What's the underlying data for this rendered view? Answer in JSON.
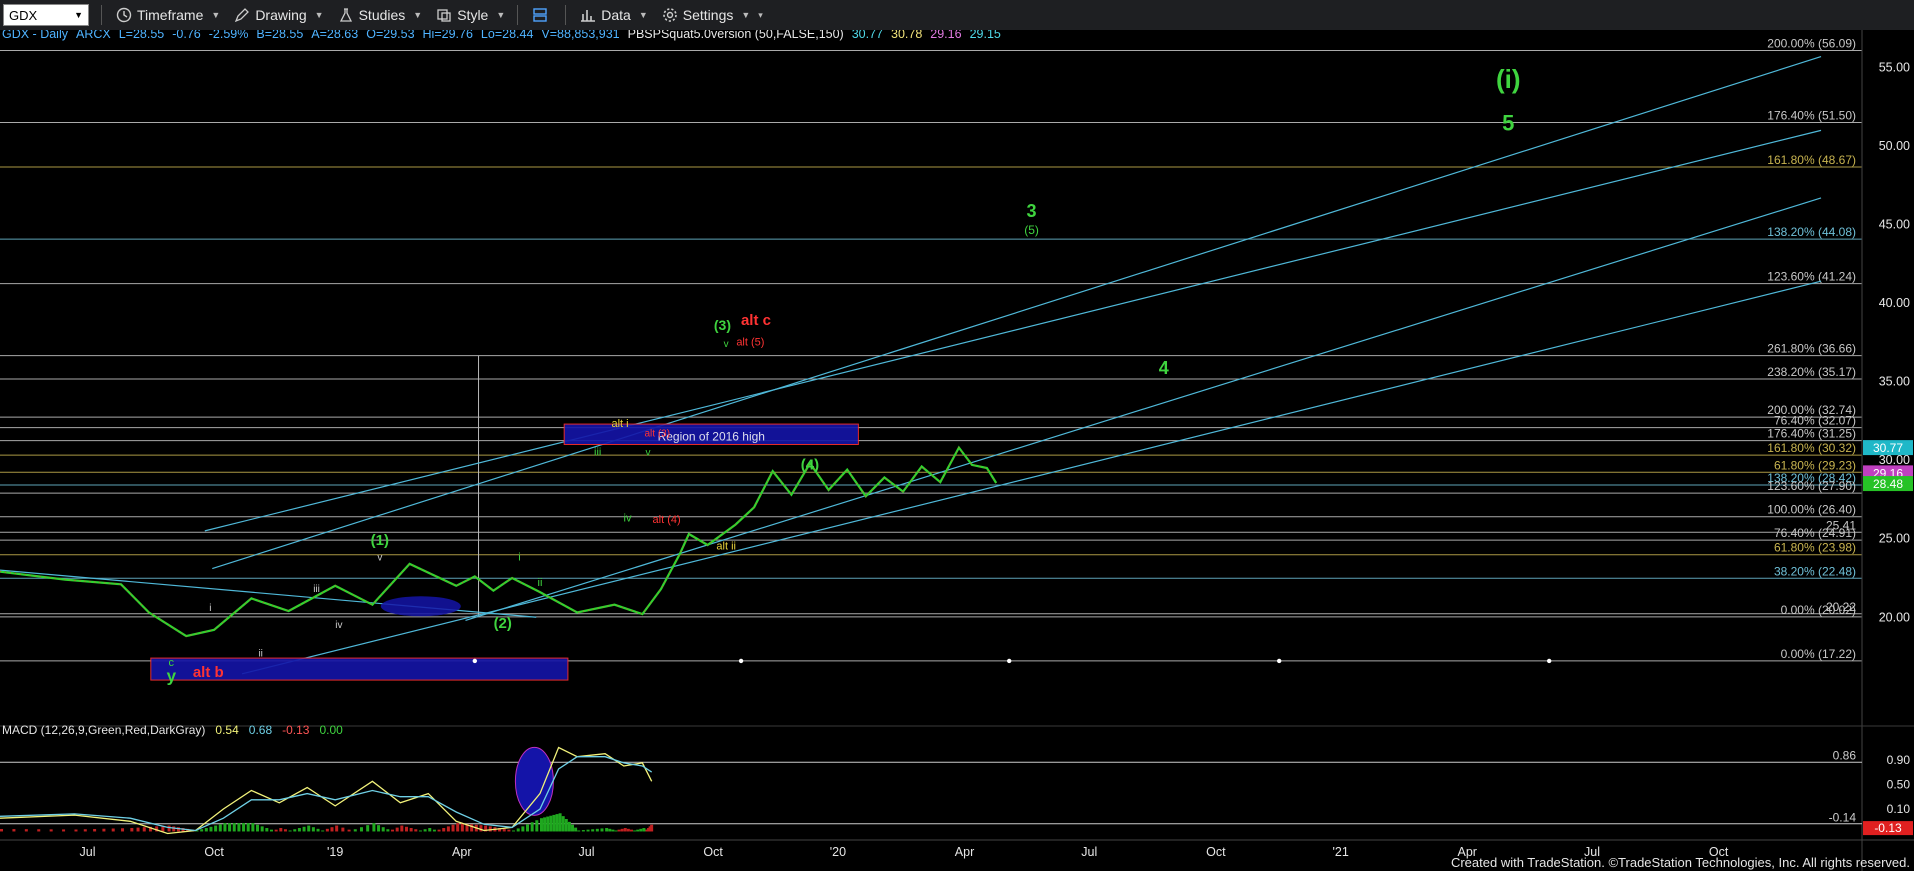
{
  "toolbar": {
    "symbol": "GDX",
    "items": [
      {
        "label": "Timeframe",
        "icon": "clock-icon"
      },
      {
        "label": "Drawing",
        "icon": "pencil-icon"
      },
      {
        "label": "Studies",
        "icon": "flask-icon"
      },
      {
        "label": "Style",
        "icon": "chart-style-icon"
      },
      {
        "label": "",
        "icon": "layout-icon"
      },
      {
        "label": "Data",
        "icon": "data-bars-icon"
      },
      {
        "label": "Settings",
        "icon": "gear-icon"
      }
    ]
  },
  "colors": {
    "background": "#000000",
    "up": "#2fd42f",
    "down": "#ff3030",
    "channel": "#4fb8d8",
    "fib": "#c8c8c8",
    "green_label": "#3fd43f",
    "red_label": "#ff3333",
    "yellow_label": "#e8d33a",
    "macd_line": "#f2f27a",
    "signal_line": "#6fd0e6"
  },
  "header": {
    "segments": [
      {
        "text": "GDX - Daily",
        "color": "#4fb3ff"
      },
      {
        "text": "ARCX",
        "color": "#4fb3ff"
      },
      {
        "text": "L=28.55",
        "color": "#4fb3ff"
      },
      {
        "text": "-0.76",
        "color": "#4fb3ff"
      },
      {
        "text": "-2.59%",
        "color": "#4fb3ff"
      },
      {
        "text": "B=28.55",
        "color": "#4fb3ff"
      },
      {
        "text": "A=28.63",
        "color": "#4fb3ff"
      },
      {
        "text": "O=29.53",
        "color": "#4fb3ff"
      },
      {
        "text": "Hi=29.76",
        "color": "#4fb3ff"
      },
      {
        "text": "Lo=28.44",
        "color": "#4fb3ff"
      },
      {
        "text": "V=88,853,931",
        "color": "#4fb3ff"
      },
      {
        "text": "PBSPSquat5.0version (50,FALSE,150)",
        "color": "#e6e6e6"
      },
      {
        "text": "30.77",
        "color": "#4fd8e8"
      },
      {
        "text": "30.78",
        "color": "#f0e27a"
      },
      {
        "text": "29.16",
        "color": "#e07ae0"
      },
      {
        "text": "29.15",
        "color": "#4fd8e8"
      }
    ]
  },
  "macd_header": {
    "segments": [
      {
        "text": "MACD (12,26,9,Green,Red,DarkGray)",
        "color": "#e6e6e6"
      },
      {
        "text": "0.54",
        "color": "#f2f27a"
      },
      {
        "text": "0.68",
        "color": "#6fd0e6"
      },
      {
        "text": "-0.13",
        "color": "#ff5555"
      },
      {
        "text": "0.00",
        "color": "#3fd43f"
      }
    ]
  },
  "footer": {
    "credit": "Created with TradeStation. ©TradeStation Technologies, Inc. All rights reserved."
  },
  "chart_data": {
    "type": "candlestick",
    "symbol": "GDX - Daily",
    "x_ticks": [
      "Jul",
      "Oct",
      "'19",
      "Apr",
      "Jul",
      "Oct",
      "'20",
      "Apr",
      "Jul",
      "Oct",
      "'21",
      "Apr",
      "Jul",
      "Oct"
    ],
    "y_ticks": [
      20.0,
      25.0,
      30.0,
      35.0,
      40.0,
      45.0,
      50.0,
      55.0
    ],
    "ylim": [
      15.75,
      56.5
    ],
    "price_path": {
      "x": [
        0,
        0.035,
        0.065,
        0.08,
        0.1,
        0.115,
        0.135,
        0.155,
        0.18,
        0.2,
        0.22,
        0.245,
        0.255,
        0.265,
        0.275,
        0.29,
        0.31,
        0.33,
        0.345,
        0.355,
        0.365,
        0.37,
        0.38,
        0.395,
        0.405,
        0.415,
        0.425,
        0.435,
        0.445,
        0.455,
        0.465,
        0.475,
        0.485,
        0.495,
        0.505,
        0.515,
        0.522,
        0.53,
        0.535
      ],
      "y": [
        22.9,
        22.4,
        22.1,
        20.3,
        18.8,
        19.2,
        21.2,
        20.4,
        22.0,
        20.8,
        23.4,
        22.0,
        22.6,
        21.7,
        22.5,
        21.6,
        20.3,
        20.8,
        20.2,
        21.8,
        24.0,
        25.3,
        24.6,
        25.9,
        27.0,
        29.3,
        27.8,
        29.8,
        28.1,
        29.4,
        27.7,
        28.9,
        28.0,
        29.6,
        28.6,
        30.8,
        29.7,
        29.5,
        28.55
      ]
    },
    "fib_levels": [
      {
        "label": "200.00% (56.09)",
        "value": 56.09,
        "color": "#c8c8c8"
      },
      {
        "label": "176.40% (51.50)",
        "value": 51.5,
        "color": "#c8c8c8"
      },
      {
        "label": "161.80% (48.67)",
        "value": 48.67,
        "color": "#c8b450"
      },
      {
        "label": "138.20% (44.08)",
        "value": 44.08,
        "color": "#6fc0d8"
      },
      {
        "label": "123.60% (41.24)",
        "value": 41.24,
        "color": "#c8c8c8"
      },
      {
        "label": "261.80% (36.66)",
        "value": 36.66,
        "color": "#c8c8c8"
      },
      {
        "label": "238.20% (35.17)",
        "value": 35.17,
        "color": "#c8c8c8"
      },
      {
        "label": "200.00% (32.74)",
        "value": 32.74,
        "color": "#c8c8c8"
      },
      {
        "label": "76.40% (32.07)",
        "value": 32.07,
        "color": "#c8c8c8"
      },
      {
        "label": "176.40% (31.25)",
        "value": 31.25,
        "color": "#c8c8c8"
      },
      {
        "label": "161.80% (30.32)",
        "value": 30.32,
        "color": "#c8b450"
      },
      {
        "label": "61.80% (29.23)",
        "value": 29.23,
        "color": "#c8b450"
      },
      {
        "label": "138.20% (28.42)",
        "value": 28.42,
        "color": "#6fc0d8"
      },
      {
        "label": "123.60% (27.90)",
        "value": 27.9,
        "color": "#c8c8c8"
      },
      {
        "label": "100.00% (26.40)",
        "value": 26.4,
        "color": "#c8c8c8"
      },
      {
        "label": "25.41",
        "value": 25.41,
        "color": "#c8c8c8"
      },
      {
        "label": "76.40% (24.91)",
        "value": 24.91,
        "color": "#c8c8c8"
      },
      {
        "label": "61.80% (23.98)",
        "value": 23.98,
        "color": "#c8b450"
      },
      {
        "label": "38.20% (22.48)",
        "value": 22.48,
        "color": "#6fc0d8"
      },
      {
        "label": "20.22",
        "value": 20.22,
        "color": "#c8c8c8"
      },
      {
        "label": "0.00% (20.02)",
        "value": 20.02,
        "color": "#c8c8c8"
      },
      {
        "label": "0.00% (17.22)",
        "value": 17.22,
        "color": "#c8c8c8"
      }
    ],
    "price_badges": [
      {
        "text": "30.77",
        "value": 30.77,
        "bg": "#1fb8c8"
      },
      {
        "text": "29.16",
        "value": 29.16,
        "bg": "#c040c0"
      },
      {
        "text": "28.48",
        "value": 28.48,
        "bg": "#26c226"
      }
    ],
    "regions": [
      {
        "label": "Region of 2016 high",
        "x0": 0.303,
        "x1": 0.461,
        "y0": 31.0,
        "y1": 32.3
      },
      {
        "label": "alt b",
        "x0": 0.081,
        "x1": 0.305,
        "y0": 16.0,
        "y1": 17.4
      }
    ],
    "wave_labels": [
      {
        "text": "(i)",
        "x": 0.81,
        "y": 53.7,
        "color": "#3fd43f",
        "size": 26
      },
      {
        "text": "5",
        "x": 0.81,
        "y": 51.0,
        "color": "#3fd43f",
        "size": 22
      },
      {
        "text": "3",
        "x": 0.554,
        "y": 45.5,
        "color": "#3fd43f",
        "size": 18
      },
      {
        "text": "(5)",
        "x": 0.554,
        "y": 44.4,
        "color": "#3fd43f",
        "size": 12
      },
      {
        "text": "4",
        "x": 0.625,
        "y": 35.5,
        "color": "#3fd43f",
        "size": 18
      },
      {
        "text": "(4)",
        "x": 0.435,
        "y": 29.4,
        "color": "#3fd43f",
        "size": 15
      },
      {
        "text": "(3)",
        "x": 0.388,
        "y": 38.3,
        "color": "#3fd43f",
        "size": 14
      },
      {
        "text": "v",
        "x": 0.39,
        "y": 37.2,
        "color": "#3fd43f",
        "size": 10
      },
      {
        "text": "alt c",
        "x": 0.406,
        "y": 38.6,
        "color": "#ff3333",
        "size": 15
      },
      {
        "text": "alt (5)",
        "x": 0.403,
        "y": 37.3,
        "color": "#ff3333",
        "size": 11
      },
      {
        "text": "alt i",
        "x": 0.333,
        "y": 32.1,
        "color": "#e8d33a",
        "size": 11
      },
      {
        "text": "alt (3)",
        "x": 0.353,
        "y": 31.5,
        "color": "#ff3333",
        "size": 10
      },
      {
        "text": "iii",
        "x": 0.321,
        "y": 30.3,
        "color": "#3fd43f",
        "size": 11
      },
      {
        "text": "v",
        "x": 0.348,
        "y": 30.3,
        "color": "#3fd43f",
        "size": 10
      },
      {
        "text": "iv",
        "x": 0.337,
        "y": 26.1,
        "color": "#3fd43f",
        "size": 11
      },
      {
        "text": "alt (4)",
        "x": 0.358,
        "y": 26.0,
        "color": "#ff3333",
        "size": 11
      },
      {
        "text": "alt ii",
        "x": 0.39,
        "y": 24.3,
        "color": "#e8d33a",
        "size": 11
      },
      {
        "text": "i",
        "x": 0.279,
        "y": 23.6,
        "color": "#3fd43f",
        "size": 11
      },
      {
        "text": "ii",
        "x": 0.29,
        "y": 22.0,
        "color": "#3fd43f",
        "size": 11
      },
      {
        "text": "(1)",
        "x": 0.204,
        "y": 24.6,
        "color": "#3fd43f",
        "size": 15
      },
      {
        "text": "v",
        "x": 0.204,
        "y": 23.6,
        "color": "#cccccc",
        "size": 10
      },
      {
        "text": "(2)",
        "x": 0.27,
        "y": 19.3,
        "color": "#3fd43f",
        "size": 15
      },
      {
        "text": "iii",
        "x": 0.17,
        "y": 21.6,
        "color": "#cccccc",
        "size": 10
      },
      {
        "text": "iv",
        "x": 0.182,
        "y": 19.3,
        "color": "#cccccc",
        "size": 10
      },
      {
        "text": "i",
        "x": 0.113,
        "y": 20.4,
        "color": "#cccccc",
        "size": 10
      },
      {
        "text": "ii",
        "x": 0.14,
        "y": 17.5,
        "color": "#cccccc",
        "size": 10
      },
      {
        "text": "c",
        "x": 0.092,
        "y": 16.9,
        "color": "#3fd43f",
        "size": 11
      },
      {
        "text": "y",
        "x": 0.092,
        "y": 15.9,
        "color": "#3fd43f",
        "size": 17
      }
    ],
    "macd": {
      "ylim": [
        -0.34,
        1.19
      ],
      "y_ticks": [
        0.9,
        0.5,
        0.1
      ],
      "ref_label": "0.86",
      "ref_value": 0.86,
      "ref_low_label": "-0.14",
      "ref_low_value": -0.14,
      "last_badge": "-0.13",
      "macd_x": [
        0,
        0.04,
        0.07,
        0.09,
        0.105,
        0.12,
        0.135,
        0.15,
        0.165,
        0.18,
        0.2,
        0.215,
        0.23,
        0.245,
        0.26,
        0.275,
        0.29,
        0.3,
        0.31,
        0.325,
        0.335,
        0.345,
        0.35
      ],
      "macd_y": [
        -0.05,
        0.0,
        -0.1,
        -0.3,
        -0.25,
        0.1,
        0.4,
        0.2,
        0.45,
        0.15,
        0.55,
        0.2,
        0.35,
        -0.1,
        -0.25,
        -0.2,
        0.35,
        1.1,
        0.95,
        1.0,
        0.8,
        0.85,
        0.55
      ],
      "signal_y": [
        -0.02,
        0.02,
        -0.05,
        -0.2,
        -0.25,
        -0.05,
        0.25,
        0.25,
        0.35,
        0.25,
        0.4,
        0.3,
        0.3,
        0.05,
        -0.15,
        -0.2,
        0.1,
        0.75,
        0.95,
        0.95,
        0.85,
        0.8,
        0.7
      ]
    }
  }
}
